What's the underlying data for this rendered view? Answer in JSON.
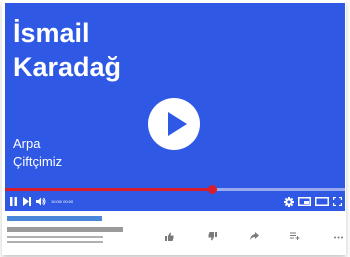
{
  "video": {
    "title_line1": "İsmail",
    "title_line2": "Karadağ",
    "subtitle_line1": "Arpa",
    "subtitle_line2": "Çiftçimiz",
    "time": "10:00/ 00:00",
    "progress_fraction": 0.61
  },
  "colors": {
    "player_bg": "#2f58e4",
    "progress_played": "#d81e2c",
    "progress_track": "#9aaaf0",
    "meta_accent": "#4a86d9"
  },
  "icons": {
    "play": "play-icon",
    "pause": "pause-icon",
    "next": "next-icon",
    "volume": "volume-icon",
    "settings": "gear-icon",
    "miniplayer": "miniplayer-icon",
    "theater": "theater-icon",
    "fullscreen": "fullscreen-icon",
    "like": "thumbs-up-icon",
    "dislike": "thumbs-down-icon",
    "share": "share-icon",
    "save": "add-to-playlist-icon",
    "more": "more-icon"
  }
}
